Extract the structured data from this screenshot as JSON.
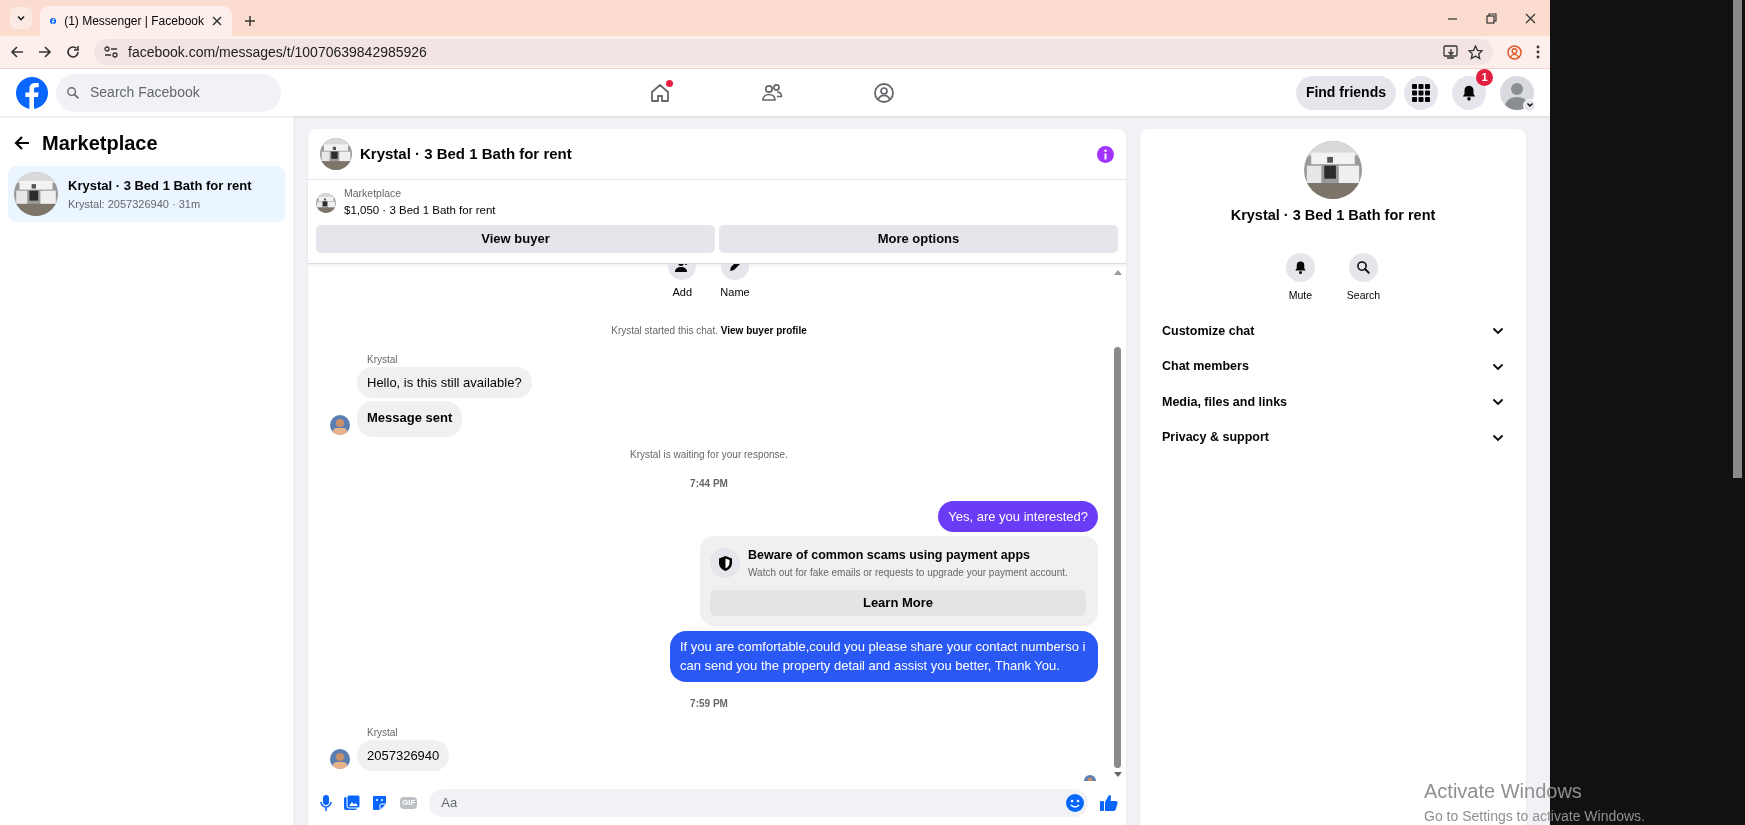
{
  "browser": {
    "tab_title": "(1) Messenger | Facebook",
    "url": "facebook.com/messages/t/10070639842985926"
  },
  "header": {
    "search_placeholder": "Search Facebook",
    "nav": [
      {
        "has_notification": true
      },
      {
        "has_notification": false
      },
      {
        "has_notification": false
      }
    ],
    "find_friends": "Find friends",
    "notification_count": "1"
  },
  "sidebar": {
    "title": "Marketplace",
    "conversations": [
      {
        "title": "Krystal · 3 Bed 1 Bath for rent",
        "preview": "Krystal: 2057326940 · 31m",
        "selected": true
      }
    ]
  },
  "chat": {
    "title": "Krystal · 3 Bed 1 Bath for rent",
    "listing": {
      "label": "Marketplace",
      "summary": "$1,050 · 3 Bed 1 Bath for rent"
    },
    "buttons": [
      "View buyer",
      "More options"
    ],
    "actions": [
      {
        "label": "Add"
      },
      {
        "label": "Name"
      }
    ],
    "messages": [
      {
        "kind": "notice",
        "text": "Krystal started this chat.",
        "link": "View buyer profile"
      },
      {
        "kind": "sender",
        "text": "Krystal"
      },
      {
        "kind": "incoming",
        "text": "Hello, is this still available?",
        "avatar": false,
        "bold": false
      },
      {
        "kind": "incoming",
        "text": "Message sent",
        "avatar": true,
        "bold": true
      },
      {
        "kind": "notice",
        "text": "Krystal is waiting for your response."
      },
      {
        "kind": "time",
        "text": "7:44 PM"
      },
      {
        "kind": "outgoing",
        "text": "Yes, are you interested?",
        "color": "#6a3cf5"
      },
      {
        "kind": "warning",
        "title": "Beware of common scams using payment apps",
        "text": "Watch out for fake emails or requests to upgrade your payment account.",
        "button": "Learn More"
      },
      {
        "kind": "outgoing",
        "text": "If you are comfortable,could you please share your contact numberso i can send you the property detail and assist you better, Thank You.",
        "color": "#2a58f4"
      },
      {
        "kind": "time",
        "text": "7:59 PM"
      },
      {
        "kind": "sender",
        "text": "Krystal"
      },
      {
        "kind": "incoming",
        "text": "2057326940",
        "avatar": true,
        "bold": false
      },
      {
        "kind": "seen"
      }
    ],
    "composer": {
      "gif_label": "GIF",
      "placeholder": "Aa"
    }
  },
  "details": {
    "title": "Krystal · 3 Bed 1 Bath for rent",
    "actions": [
      {
        "label": "Mute"
      },
      {
        "label": "Search"
      }
    ],
    "sections": [
      {
        "label": "Customize chat",
        "expanded": false
      },
      {
        "label": "Chat members",
        "expanded": false
      },
      {
        "label": "Media, files and links",
        "expanded": false
      },
      {
        "label": "Privacy & support",
        "expanded": false
      }
    ]
  },
  "os_notice": {
    "title": "Activate Windows",
    "text": "Go to Settings to activate Windows."
  }
}
